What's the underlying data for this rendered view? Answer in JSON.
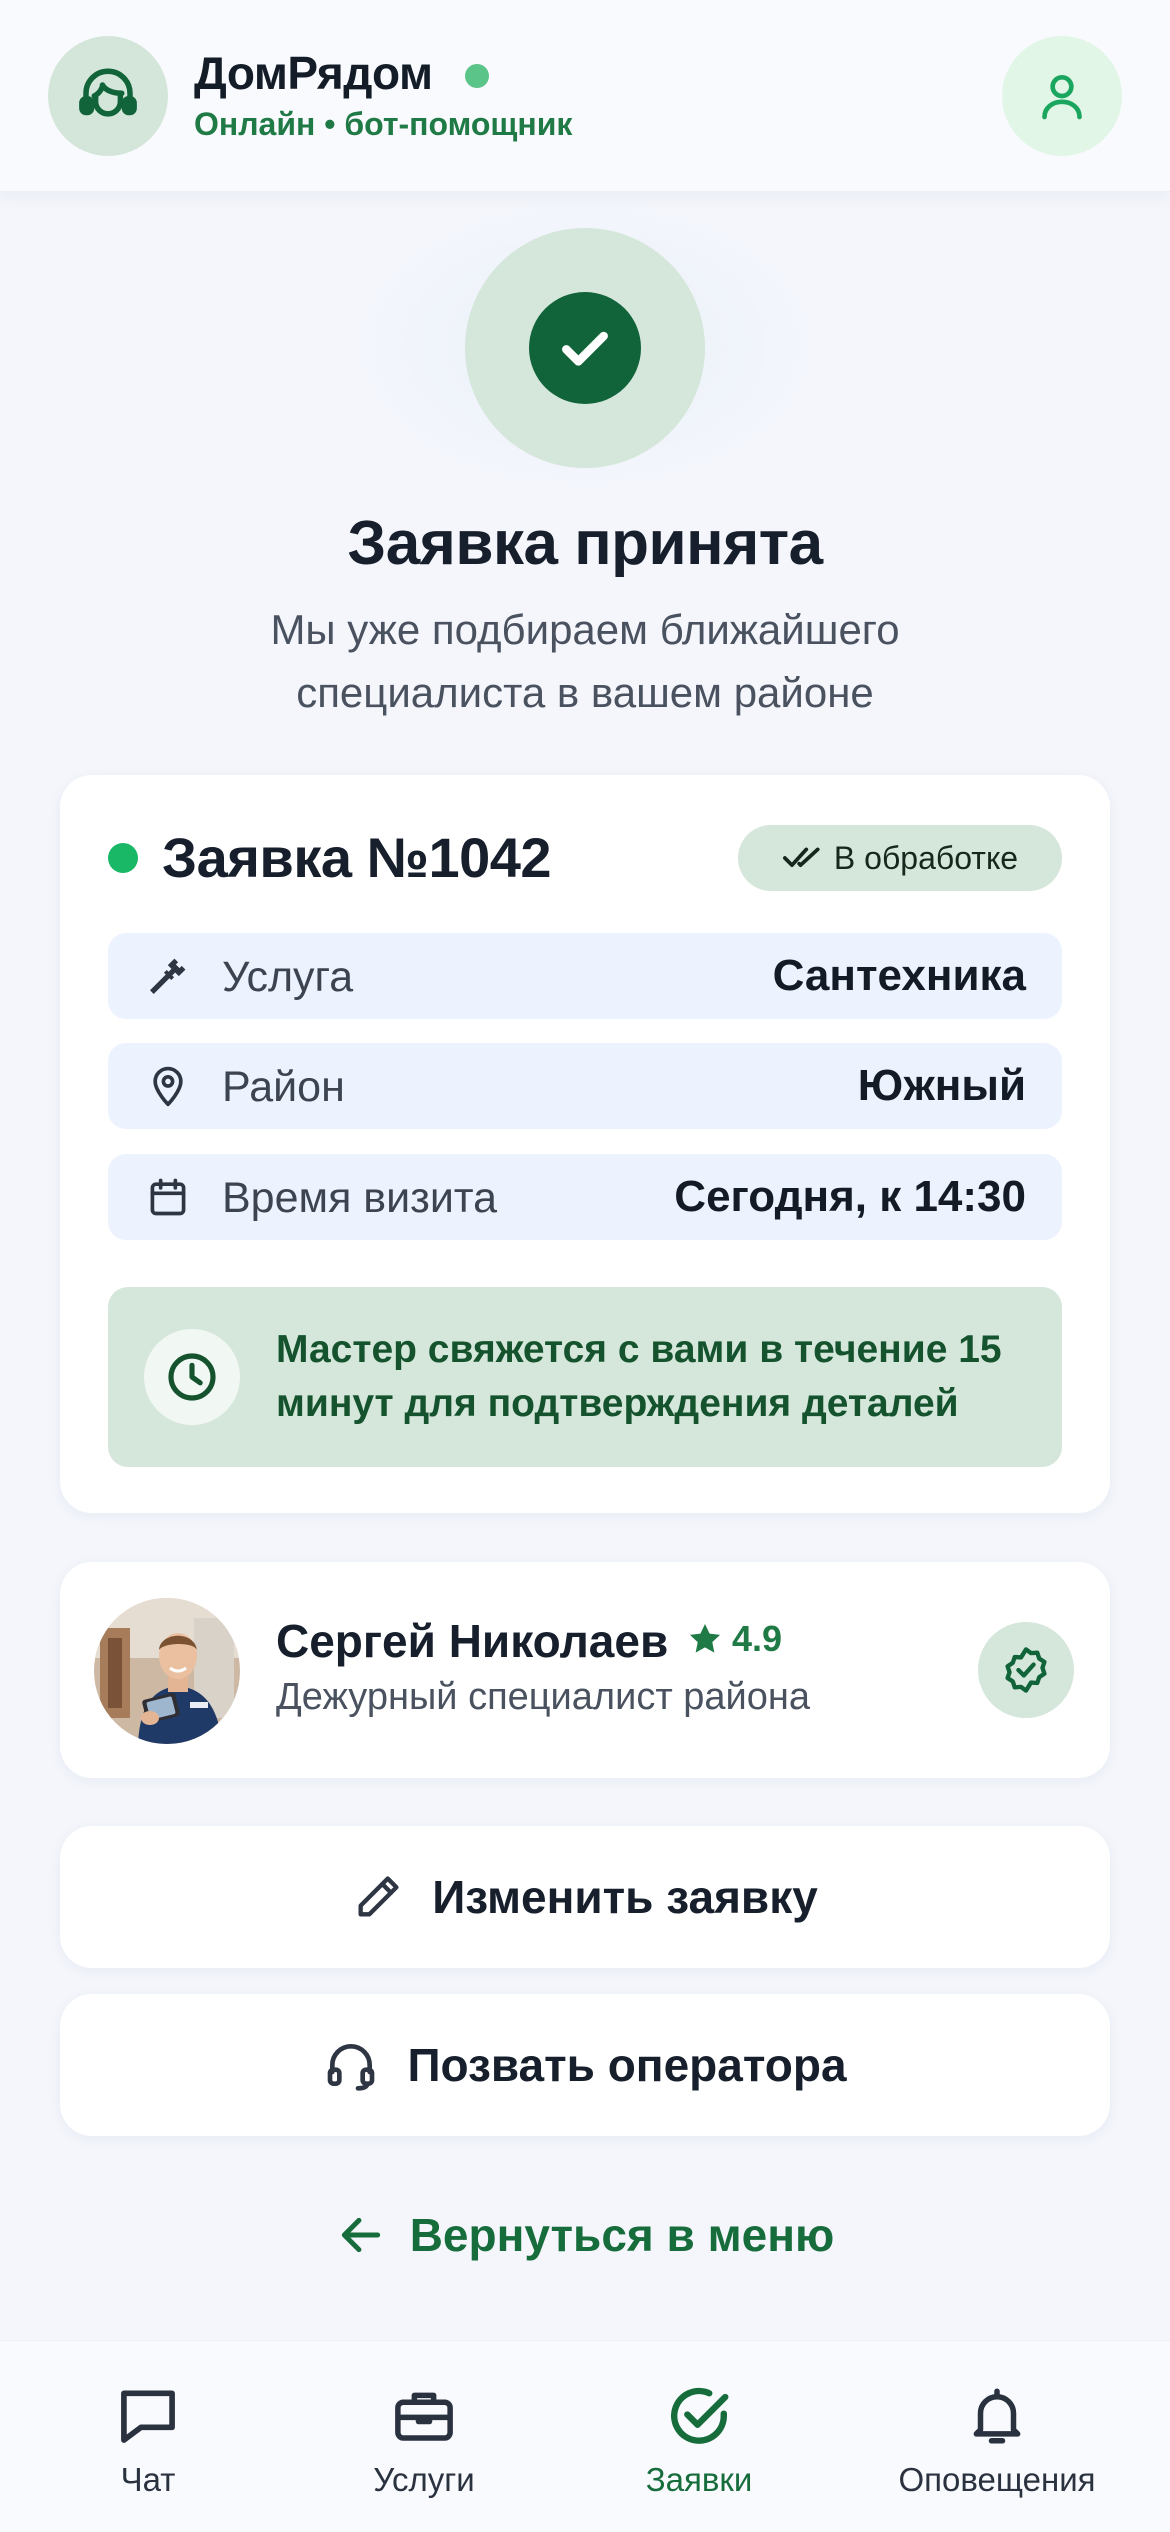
{
  "header": {
    "title": "ДомРядом",
    "subtitle": "Онлайн • бот-помощник",
    "bot_avatar_icon": "support-agent-icon",
    "profile_icon": "user-icon"
  },
  "success": {
    "icon": "check-circle-icon",
    "title": "Заявка принята",
    "subtitle": "Мы уже подбираем ближайшего специалиста в вашем районе"
  },
  "order": {
    "title": "Заявка №1042",
    "status": "В обработке",
    "rows": [
      {
        "icon": "wrench-icon",
        "label": "Услуга",
        "value": "Сантехника"
      },
      {
        "icon": "map-pin-icon",
        "label": "Район",
        "value": "Южный"
      },
      {
        "icon": "calendar-icon",
        "label": "Время визита",
        "value": "Сегодня, к 14:30"
      }
    ],
    "notice": "Мастер свяжется с вами в течение 15 минут для подтверждения деталей"
  },
  "specialist": {
    "name": "Сергей Николаев",
    "rating": "4.9",
    "role": "Дежурный специалист района"
  },
  "actions": {
    "edit": "Изменить заявку",
    "call_operator": "Позвать оператора",
    "back": "Вернуться в меню"
  },
  "tabs": [
    {
      "label": "Чат",
      "icon": "chat-icon",
      "active": false
    },
    {
      "label": "Услуги",
      "icon": "briefcase-icon",
      "active": false
    },
    {
      "label": "Заявки",
      "icon": "check-circle-icon",
      "active": true
    },
    {
      "label": "Оповещения",
      "icon": "bell-icon",
      "active": false
    }
  ],
  "colors": {
    "brand_green": "#11643a",
    "accent_green": "#1f7a45",
    "soft_green": "#d5e6da",
    "row_blue": "#ecf2fe",
    "background": "#f4f6fc"
  }
}
